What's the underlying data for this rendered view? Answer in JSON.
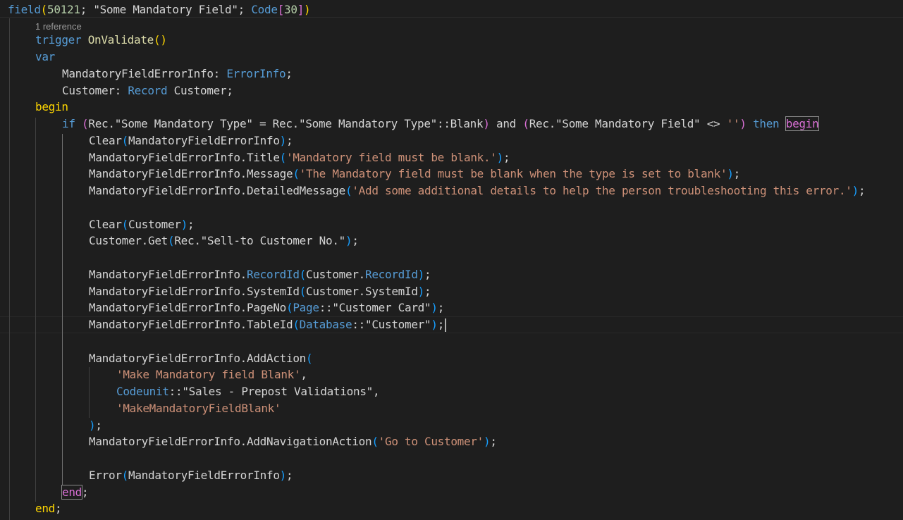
{
  "editor": {
    "language": "AL",
    "theme_colors": {
      "background": "#1e1e1e",
      "keyword": "#569cd6",
      "control": "#c586c0",
      "string": "#ce9178",
      "text": "#d4d4d4",
      "bracket_level1": "#ffd700",
      "bracket_level2": "#da70d6",
      "bracket_level3": "#179fff"
    },
    "codelens_reference": "1 reference",
    "lines": [
      "field(50121; \"Some Mandatory Field\"; Code[30])",
      "1 reference",
      "trigger OnValidate()",
      "var",
      "    MandatoryFieldErrorInfo: ErrorInfo;",
      "    Customer: Record Customer;",
      "begin",
      "    if (Rec.\"Some Mandatory Type\" = Rec.\"Some Mandatory Type\"::Blank) and (Rec.\"Some Mandatory Field\" <> '') then begin",
      "        Clear(MandatoryFieldErrorInfo);",
      "        MandatoryFieldErrorInfo.Title('Mandatory field must be blank.');",
      "        MandatoryFieldErrorInfo.Message('The Mandatory field must be blank when the type is set to blank');",
      "        MandatoryFieldErrorInfo.DetailedMessage('Add some additional details to help the person troubleshooting this error.');",
      "",
      "        Clear(Customer);",
      "        Customer.Get(Rec.\"Sell-to Customer No.\");",
      "",
      "        MandatoryFieldErrorInfo.RecordId(Customer.RecordId);",
      "        MandatoryFieldErrorInfo.SystemId(Customer.SystemId);",
      "        MandatoryFieldErrorInfo.PageNo(Page::\"Customer Card\");",
      "        MandatoryFieldErrorInfo.TableId(Database::\"Customer\");",
      "",
      "        MandatoryFieldErrorInfo.AddAction(",
      "            'Make Mandatory field Blank',",
      "            Codeunit::\"Sales - Prepost Validations\",",
      "            'MakeMandatoryFieldBlank'",
      "        );",
      "        MandatoryFieldErrorInfo.AddNavigationAction('Go to Customer');",
      "",
      "        Error(MandatoryFieldErrorInfo);",
      "    end;",
      "end;"
    ]
  }
}
